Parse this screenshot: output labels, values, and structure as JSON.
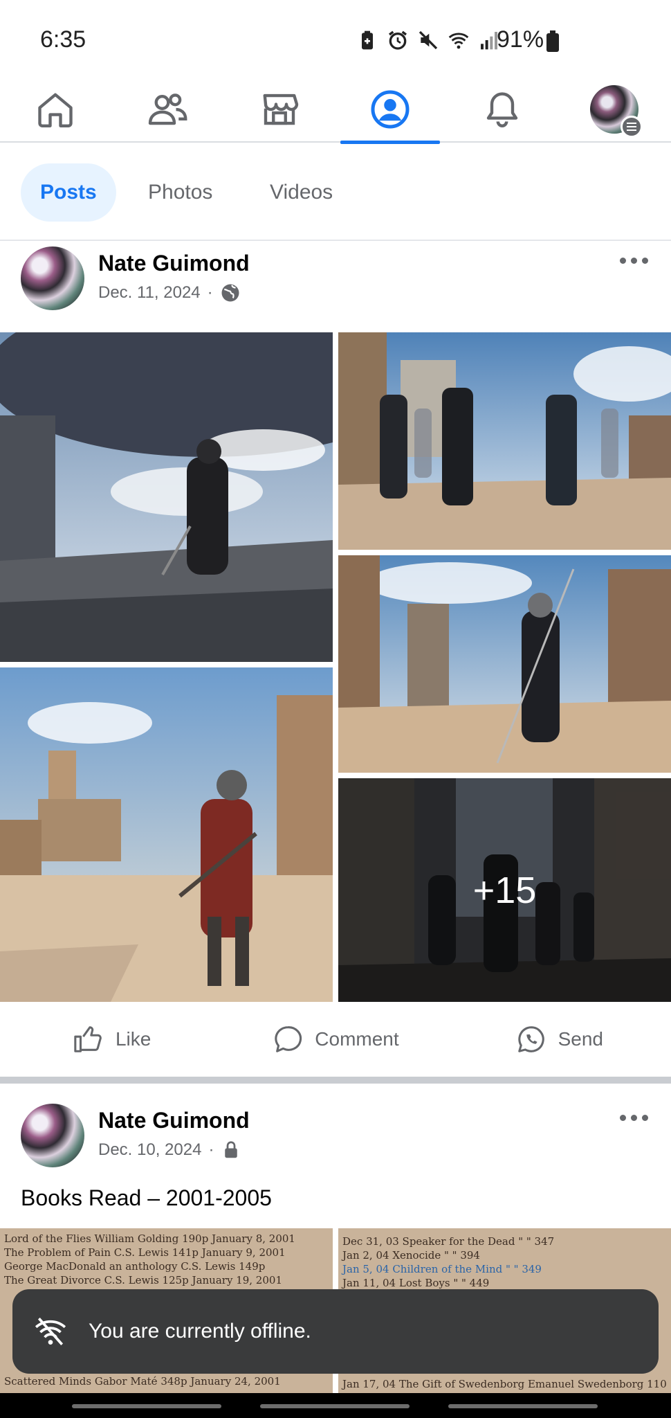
{
  "status_bar": {
    "time": "6:35",
    "battery_percent": "91%",
    "icons": [
      "battery-saver-icon",
      "alarm-icon",
      "mute-icon",
      "wifi-icon",
      "signal-icon"
    ]
  },
  "top_nav": {
    "items": [
      {
        "name": "home",
        "icon": "home-icon"
      },
      {
        "name": "friends",
        "icon": "friends-icon"
      },
      {
        "name": "marketplace",
        "icon": "marketplace-icon"
      },
      {
        "name": "profile",
        "icon": "profile-icon",
        "active": true
      },
      {
        "name": "notifications",
        "icon": "bell-icon"
      },
      {
        "name": "menu",
        "icon": "avatar-menu-icon"
      }
    ],
    "accent": "#1877f2"
  },
  "sub_tabs": [
    {
      "label": "Posts",
      "active": true
    },
    {
      "label": "Photos"
    },
    {
      "label": "Videos"
    }
  ],
  "posts": [
    {
      "author": "Nate Guimond",
      "date": "Dec. 11, 2024",
      "separator": "·",
      "privacy_icon": "globe-icon",
      "extra_photos": "+15"
    },
    {
      "author": "Nate Guimond",
      "date": "Dec. 10, 2024",
      "separator": "·",
      "privacy_icon": "lock-icon",
      "text": "Books Read – 2001-2005"
    }
  ],
  "actions": {
    "like": "Like",
    "comment": "Comment",
    "send": "Send"
  },
  "book_list_left": [
    "Lord of the Flies   William Golding   190p   January 8, 2001",
    "The Problem of Pain   C.S. Lewis   141p   January 9, 2001",
    "George MacDonald an anthology  C.S. Lewis  149p",
    "The Great Divorce   C.S. Lewis   125p   January 19, 2001",
    "Scattered Minds   Gabor Maté   348p   January 24, 2001"
  ],
  "book_list_right": [
    "Dec 31, 03  Speaker for the Dead   \"   \"   347",
    "Jan 2, 04  Xenocide   \"   \"   394",
    "Jan 5, 04  Children of the Mind   \"   \"   349",
    "Jan 11, 04  Lost Boys   \"   \"   449",
    "Jan 17, 04  The Gift of Swedenborg   Emanuel Swedenborg   110"
  ],
  "toast": {
    "icon": "wifi-off-icon",
    "message": "You are currently offline."
  }
}
